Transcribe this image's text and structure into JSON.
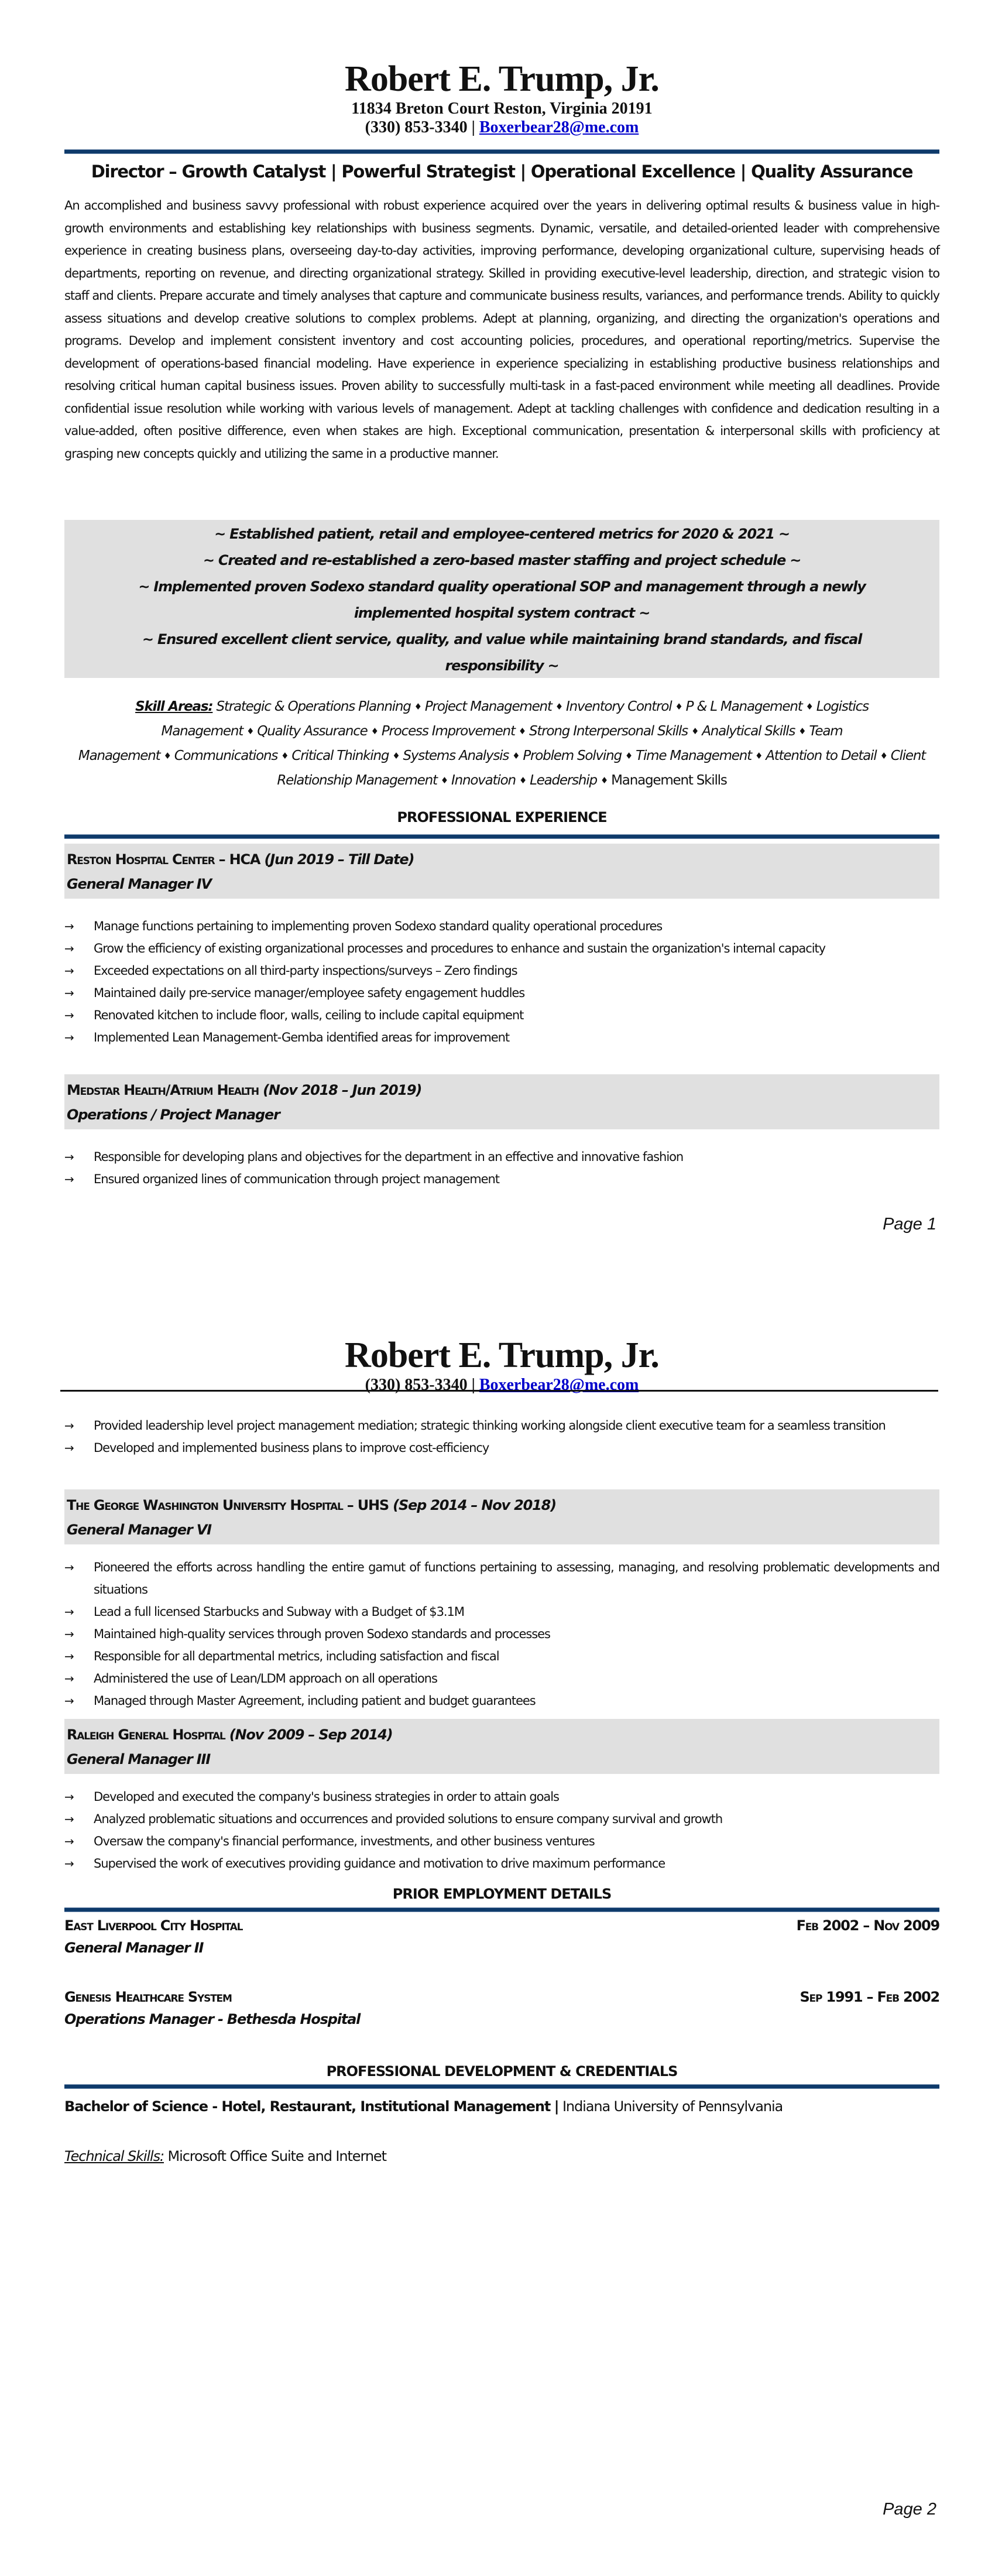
{
  "header": {
    "name": "Robert E. Trump, Jr.",
    "address": "11834 Breton Court Reston, Virginia 20191",
    "phone": "(330) 853-3340",
    "separator": "|",
    "email": "Boxerbear28@me.com"
  },
  "headline": "Director – Growth Catalyst | Powerful Strategist | Operational Excellence | Quality Assurance",
  "summary": "An accomplished and business savvy professional with robust experience acquired over the years in delivering optimal results & business value in high-growth environments and establishing key relationships with business segments. Dynamic, versatile, and detailed-oriented leader with comprehensive experience in creating business plans, overseeing day-to-day activities, improving performance, developing organizational culture, supervising heads of departments, reporting on revenue, and directing organizational strategy. Skilled in providing executive-level leadership, direction, and strategic vision to staff and clients. Prepare accurate and timely analyses that capture and communicate business results, variances, and performance trends. Ability to quickly assess situations and develop creative solutions to complex problems. Adept at planning, organizing, and directing the organization's operations and programs. Develop and implement consistent inventory and cost accounting policies, procedures, and operational reporting/metrics. Supervise the development of operations-based financial modeling. Have experience in experience specializing in establishing productive business relationships and resolving critical human capital business issues. Proven ability to successfully multi-task in a fast-paced environment while meeting all deadlines. Provide confidential issue resolution while working with various levels of management. Adept at tackling challenges with confidence and dedication resulting in a value-added, often positive difference, even when stakes are high. Exceptional communication, presentation & interpersonal skills with proficiency at grasping new concepts quickly and utilizing the same in a productive manner.",
  "achievements": [
    "~ Established patient, retail and employee-centered metrics for 2020 & 2021 ~",
    "~ Created and re-established a zero-based master staffing and project schedule ~",
    "~ Implemented proven Sodexo standard quality operational SOP and management through a newly implemented hospital system contract ~",
    "~ Ensured excellent client service, quality, and value while maintaining brand standards, and fiscal responsibility ~"
  ],
  "skills": {
    "label": "Skill Areas:",
    "bullet_glyph": "♦",
    "items": [
      "Strategic & Operations Planning",
      "Project Management",
      "Inventory Control",
      "P & L Management",
      "Logistics Management",
      "Quality Assurance",
      "Process Improvement",
      "Strong Interpersonal Skills",
      "Analytical Skills",
      "Team Management",
      "Communications",
      "Critical Thinking",
      "Systems Analysis",
      "Problem Solving",
      "Time Management",
      "Attention to Detail",
      "Client Relationship Management",
      "Innovation",
      "Leadership",
      "Management Skills"
    ]
  },
  "sections": {
    "experience": "PROFESSIONAL EXPERIENCE",
    "prior": "PRIOR EMPLOYMENT DETAILS",
    "development": "PROFESSIONAL DEVELOPMENT & CREDENTIALS"
  },
  "bullet_icon": "→",
  "jobs": [
    {
      "company": "Reston Hospital Center – HCA",
      "dates": "(Jun 2019 – Till Date)",
      "title": "General Manager IV",
      "bullets": [
        "Manage functions pertaining to implementing proven Sodexo standard quality operational procedures",
        "Grow the efficiency of existing organizational processes and procedures to enhance and sustain the organization's internal capacity",
        "Exceeded expectations on all third-party inspections/surveys – Zero findings",
        "Maintained daily pre-service manager/employee safety engagement huddles",
        "Renovated kitchen to include floor, walls, ceiling to include capital equipment",
        "Implemented Lean Management-Gemba identified areas for improvement"
      ]
    },
    {
      "company": "Medstar Health/Atrium Health",
      "dates": "(Nov 2018 – Jun 2019)",
      "title": "Operations / Project Manager",
      "bullets": [
        "Responsible for developing plans and objectives for the department in an effective and innovative fashion",
        "Ensured organized lines of communication through project management",
        "Provided leadership level project management mediation; strategic thinking working alongside client executive team for a seamless transition",
        "Developed and implemented business plans to improve cost-efficiency"
      ]
    },
    {
      "company": "The George Washington University Hospital – UHS",
      "dates": "(Sep 2014 – Nov 2018)",
      "title": "General Manager VI",
      "bullets": [
        "Pioneered the efforts across handling the entire gamut of functions pertaining to assessing, managing, and resolving problematic developments and situations",
        "Lead a full licensed Starbucks and Subway with a Budget of $3.1M",
        "Maintained high-quality services through proven Sodexo standards and processes",
        "Responsible for all departmental metrics, including satisfaction and fiscal",
        "Administered the use of Lean/LDM approach on all operations",
        "Managed through Master Agreement, including patient and budget guarantees"
      ]
    },
    {
      "company": "Raleigh General Hospital",
      "dates": "(Nov 2009 – Sep 2014)",
      "title": "General Manager III",
      "bullets": [
        "Developed and executed the company's business strategies in order to attain goals",
        "Analyzed problematic situations and occurrences and provided solutions to ensure company survival and growth",
        "Oversaw the company's financial performance, investments, and other business ventures",
        "Supervised the work of executives providing guidance and motivation to drive maximum performance"
      ]
    }
  ],
  "prior_jobs": [
    {
      "company": "East Liverpool City Hospital",
      "dates": "Feb 2002 – Nov 2009",
      "title": "General Manager II"
    },
    {
      "company": "Genesis Healthcare System",
      "dates": "Sep 1991 – Feb 2002",
      "title": "Operations Manager - Bethesda Hospital"
    }
  ],
  "education": {
    "degree": "Bachelor of Science - Hotel, Restaurant, Institutional Management",
    "separator": "|",
    "school": "Indiana University of Pennsylvania"
  },
  "technical": {
    "label": "Technical Skills:",
    "value": "Microsoft Office Suite and Internet"
  },
  "pages": [
    "Page 1",
    "Page 2"
  ],
  "colors": {
    "rule": "#0e3a6a",
    "band": "#e0e0e0",
    "link": "#0000cc"
  }
}
